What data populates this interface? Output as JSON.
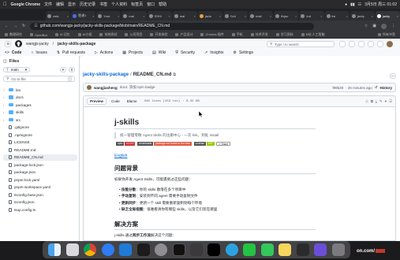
{
  "menubar": {
    "app_name": "Google Chrome",
    "items": [
      "文件",
      "编辑",
      "显示",
      "历史记录",
      "书签",
      "个人资料",
      "标签页",
      "窗口",
      "帮助"
    ],
    "datetime": "3月5日 周三 01:02"
  },
  "tabs": [
    {
      "label": "zsid-"
    },
    {
      "label": "智谱1"
    },
    {
      "label": "Your"
    },
    {
      "label": "mai"
    },
    {
      "label": "SSHi"
    },
    {
      "label": "mai"
    },
    {
      "label": "jaclo"
    },
    {
      "label": "Scri"
    },
    {
      "label": "maii"
    },
    {
      "label": "fixjac"
    },
    {
      "label": "Ind"
    },
    {
      "label": "ilsi"
    },
    {
      "label": "jacky"
    },
    {
      "label": "jacky"
    }
  ],
  "address": {
    "url": "github.com/wangjs-jacky/jacky-skills-package/blob/main/README_CN.md"
  },
  "bookmarks": [
    "数理研究",
    "OpenBot",
    "AI 记忆",
    "AI小组",
    "系统测试",
    "公司项目",
    "开发体验",
    "产品设计",
    "Chrome 插件",
    "手机",
    "技术开发",
    "学习资料",
    "B站 人工智能",
    "所有书签"
  ],
  "github": {
    "owner": "wangjs-jacky",
    "separator": "/",
    "repo": "jacky-skills-package",
    "search_placeholder": "Type / to search",
    "nav": [
      "Code",
      "Issues",
      "Pull requests",
      "Actions",
      "Projects",
      "Wiki",
      "Security",
      "Insights",
      "Settings"
    ]
  },
  "sidebar": {
    "title": "Files",
    "branch": "main",
    "goto_placeholder": "Go to file",
    "goto_shortcut": "t",
    "tree": [
      {
        "name": "bin",
        "type": "folder"
      },
      {
        "name": "docs",
        "type": "folder"
      },
      {
        "name": "packages",
        "type": "folder"
      },
      {
        "name": "skills",
        "type": "folder"
      },
      {
        "name": "src",
        "type": "folder"
      },
      {
        "name": ".gitignore",
        "type": "file"
      },
      {
        "name": ".npmignore",
        "type": "file"
      },
      {
        "name": "LICENSE",
        "type": "file"
      },
      {
        "name": "README.md",
        "type": "file"
      },
      {
        "name": "README_CN.md",
        "type": "file",
        "selected": true
      },
      {
        "name": "package-lock.json",
        "type": "file"
      },
      {
        "name": "package.json",
        "type": "file"
      },
      {
        "name": "pnpm-lock.yaml",
        "type": "file"
      },
      {
        "name": "pnpm-workspace.yaml",
        "type": "file"
      },
      {
        "name": "tsconfig.base.json",
        "type": "file"
      },
      {
        "name": "tsconfig.json",
        "type": "file"
      },
      {
        "name": "tsup.config.ts",
        "type": "file"
      }
    ]
  },
  "breadcrumb": {
    "repo": "jacky-skills-package",
    "separator": "/",
    "file": "README_CN.md"
  },
  "commit": {
    "author": "wangjiasheng",
    "message": "docs: 添加 npm badge",
    "hash": "f99b28",
    "time": "· 26 minutes ago",
    "history": "History"
  },
  "file_toolbar": {
    "preview": "Preview",
    "code": "Code",
    "blame": "Blame",
    "lines": "346 lines (253 loc)",
    "size": "· 8.32 KB"
  },
  "readme": {
    "title": "j-skills",
    "quote": "统一管理零散 Agent Skills 的注册中心 - 一次 link，到处 install",
    "badges": [
      {
        "label": "npm",
        "value": "v1.0.0",
        "color": "#cb3837"
      },
      {
        "label": "downloads",
        "value": "package not found or too new",
        "color": "#e05d44"
      },
      {
        "label": "License",
        "value": "MIT",
        "color": "#97ca00"
      }
    ],
    "share_label": "Share",
    "english_link": "English",
    "section1": "问题背景",
    "intro": "如果你开发 Agent Skills，可能遇到过这些问题：",
    "bullets": [
      {
        "term": "技能分散",
        "text": "：你的 skills 散落在多个项目中"
      },
      {
        "term": "手动复制",
        "text": "：安装到不同 agent 需要手动复制文件"
      },
      {
        "term": "更新同步",
        "text": "：更新一个 skill 需要重新复制到每个环境"
      },
      {
        "term": "缺乏全局视图",
        "text": "：很难看清你有哪些 skills，以及它们装在哪里"
      }
    ],
    "section2": "解决方案",
    "solution_prefix": "j-skills 通过",
    "solution_bold": "两步工作流",
    "solution_suffix": "解决这个问题："
  },
  "dock_overlay_text": "on.com/"
}
